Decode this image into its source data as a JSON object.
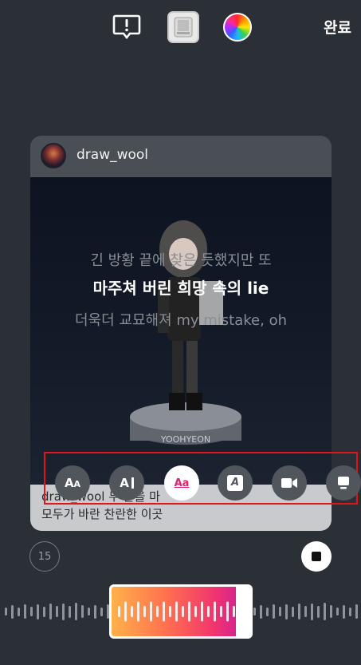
{
  "toolbar": {
    "report_icon": "exclamation-bubble-icon",
    "sticker_icon": "sticker-thumbnail-icon",
    "color_icon": "color-wheel-icon",
    "done_label": "완료"
  },
  "card": {
    "username": "draw_wool",
    "lyrics": {
      "previous": "긴 방황 끝에 찾은 듯했지만 또",
      "current": "마주쳐 버린 희망 속의 lie",
      "next": "더욱더 교묘해져 my mistake, oh"
    },
    "figure_caption": "YOOHYEON",
    "footer_line1": "draw_wool 두 눈을 마",
    "footer_line2": "모두가 바란 찬란한 이곳"
  },
  "style_bar": {
    "options": [
      {
        "icon": "text-aa-icon",
        "label": "Aa",
        "active": false
      },
      {
        "icon": "text-ai-icon",
        "label": "A I",
        "active": false
      },
      {
        "icon": "text-underline-aa-icon",
        "label": "Aa",
        "active": true
      },
      {
        "icon": "text-box-a-icon",
        "label": "A",
        "active": false
      },
      {
        "icon": "video-icon",
        "label": "",
        "active": false
      },
      {
        "icon": "card-icon",
        "label": "",
        "active": false
      }
    ],
    "accent_color": "#e0161a"
  },
  "controls": {
    "timer_label": "15",
    "stop_icon": "stop-icon"
  },
  "scrubber": {
    "clip_gradient": [
      "#ffb14a",
      "#ff6f4f",
      "#f1336f",
      "#c41aa2"
    ]
  }
}
